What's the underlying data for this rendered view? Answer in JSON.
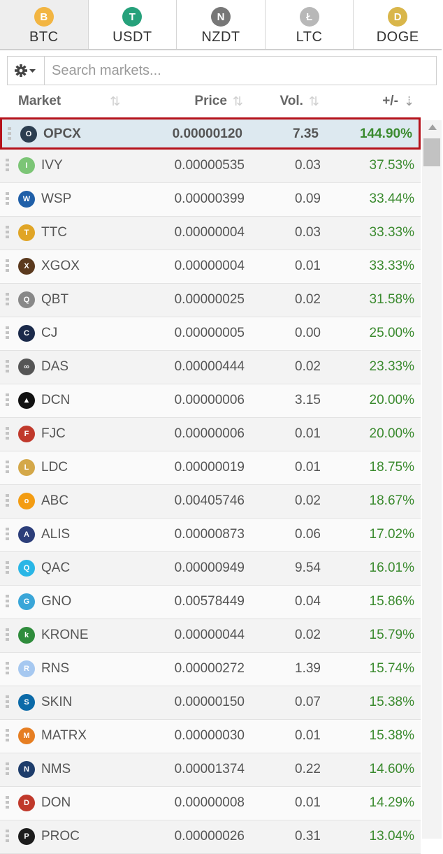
{
  "tabs": [
    {
      "label": "BTC",
      "icon": "bitcoin-icon",
      "color": "#f2b542",
      "glyph": "B"
    },
    {
      "label": "USDT",
      "icon": "tether-icon",
      "color": "#26a17b",
      "glyph": "T"
    },
    {
      "label": "NZDT",
      "icon": "nzdt-icon",
      "color": "#777777",
      "glyph": "N"
    },
    {
      "label": "LTC",
      "icon": "litecoin-icon",
      "color": "#b8b8b8",
      "glyph": "Ł"
    },
    {
      "label": "DOGE",
      "icon": "dogecoin-icon",
      "color": "#d9b64a",
      "glyph": "D"
    }
  ],
  "search": {
    "placeholder": "Search markets...",
    "value": ""
  },
  "columns": {
    "market": "Market",
    "price": "Price",
    "vol": "Vol.",
    "change": "+/-"
  },
  "rows": [
    {
      "symbol": "OPCX",
      "price": "0.00000120",
      "vol": "7.35",
      "change": "144.90%",
      "icon_color": "#2c3e50",
      "glyph": "O"
    },
    {
      "symbol": "IVY",
      "price": "0.00000535",
      "vol": "0.03",
      "change": "37.53%",
      "icon_color": "#7cc576",
      "glyph": "I"
    },
    {
      "symbol": "WSP",
      "price": "0.00000399",
      "vol": "0.09",
      "change": "33.44%",
      "icon_color": "#1f5fa8",
      "glyph": "W"
    },
    {
      "symbol": "TTC",
      "price": "0.00000004",
      "vol": "0.03",
      "change": "33.33%",
      "icon_color": "#e0a526",
      "glyph": "T"
    },
    {
      "symbol": "XGOX",
      "price": "0.00000004",
      "vol": "0.01",
      "change": "33.33%",
      "icon_color": "#5b3a1e",
      "glyph": "X"
    },
    {
      "symbol": "QBT",
      "price": "0.00000025",
      "vol": "0.02",
      "change": "31.58%",
      "icon_color": "#888888",
      "glyph": "Q"
    },
    {
      "symbol": "CJ",
      "price": "0.00000005",
      "vol": "0.00",
      "change": "25.00%",
      "icon_color": "#1b2a4a",
      "glyph": "C"
    },
    {
      "symbol": "DAS",
      "price": "0.00000444",
      "vol": "0.02",
      "change": "23.33%",
      "icon_color": "#555555",
      "glyph": "∞"
    },
    {
      "symbol": "DCN",
      "price": "0.00000006",
      "vol": "3.15",
      "change": "20.00%",
      "icon_color": "#111111",
      "glyph": "▲"
    },
    {
      "symbol": "FJC",
      "price": "0.00000006",
      "vol": "0.01",
      "change": "20.00%",
      "icon_color": "#c0392b",
      "glyph": "F"
    },
    {
      "symbol": "LDC",
      "price": "0.00000019",
      "vol": "0.01",
      "change": "18.75%",
      "icon_color": "#d4a849",
      "glyph": "L"
    },
    {
      "symbol": "ABC",
      "price": "0.00405746",
      "vol": "0.02",
      "change": "18.67%",
      "icon_color": "#f39c12",
      "glyph": "o"
    },
    {
      "symbol": "ALIS",
      "price": "0.00000873",
      "vol": "0.06",
      "change": "17.02%",
      "icon_color": "#2c3e7a",
      "glyph": "A"
    },
    {
      "symbol": "QAC",
      "price": "0.00000949",
      "vol": "9.54",
      "change": "16.01%",
      "icon_color": "#29b6e6",
      "glyph": "Q"
    },
    {
      "symbol": "GNO",
      "price": "0.00578449",
      "vol": "0.04",
      "change": "15.86%",
      "icon_color": "#3aa6d8",
      "glyph": "G"
    },
    {
      "symbol": "KRONE",
      "price": "0.00000044",
      "vol": "0.02",
      "change": "15.79%",
      "icon_color": "#2f8c3c",
      "glyph": "k"
    },
    {
      "symbol": "RNS",
      "price": "0.00000272",
      "vol": "1.39",
      "change": "15.74%",
      "icon_color": "#a6c8f0",
      "glyph": "R"
    },
    {
      "symbol": "SKIN",
      "price": "0.00000150",
      "vol": "0.07",
      "change": "15.38%",
      "icon_color": "#0b6aa8",
      "glyph": "S"
    },
    {
      "symbol": "MATRX",
      "price": "0.00000030",
      "vol": "0.01",
      "change": "15.38%",
      "icon_color": "#e67e22",
      "glyph": "M"
    },
    {
      "symbol": "NMS",
      "price": "0.00001374",
      "vol": "0.22",
      "change": "14.60%",
      "icon_color": "#1e3d6b",
      "glyph": "N"
    },
    {
      "symbol": "DON",
      "price": "0.00000008",
      "vol": "0.01",
      "change": "14.29%",
      "icon_color": "#c0392b",
      "glyph": "D"
    },
    {
      "symbol": "PROC",
      "price": "0.00000026",
      "vol": "0.31",
      "change": "13.04%",
      "icon_color": "#1c1c1c",
      "glyph": "P"
    }
  ],
  "colors": {
    "accent_green": "#3a8a2e",
    "selected_border": "#b5121b",
    "selected_bg": "#dde9f0"
  }
}
